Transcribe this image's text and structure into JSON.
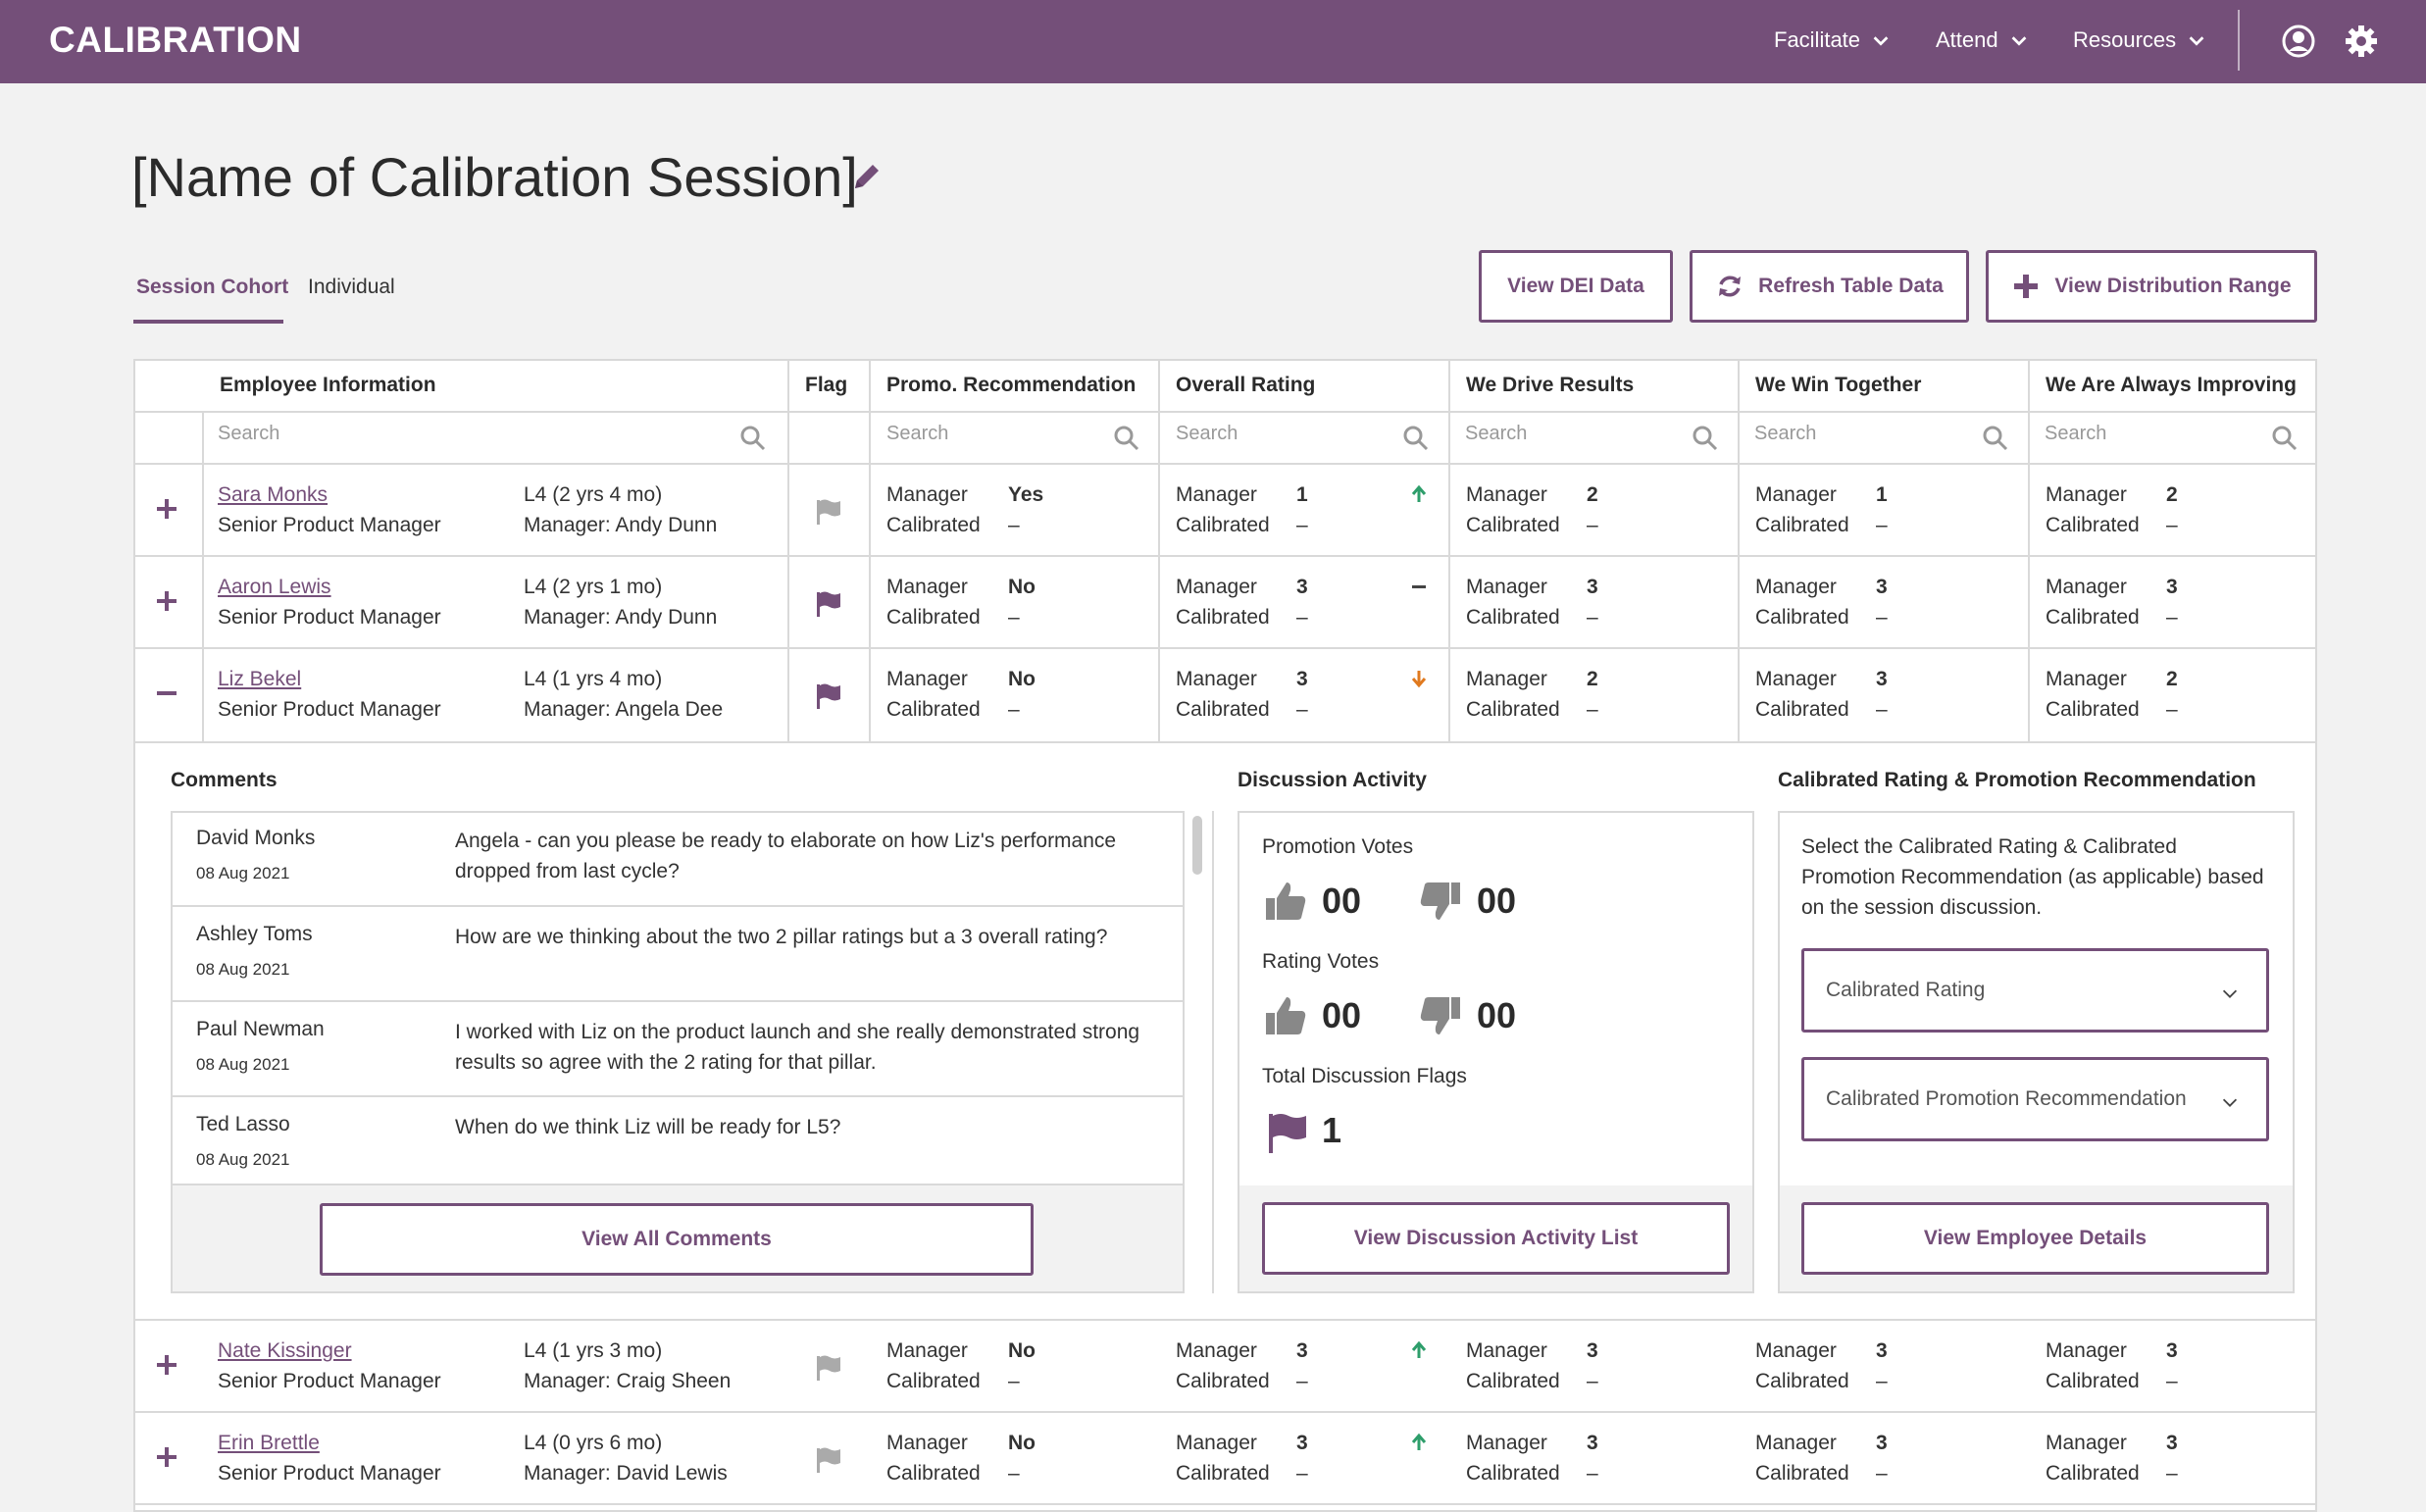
{
  "app": {
    "logo": "CALIBRATION"
  },
  "nav": {
    "facilitate": "Facilitate",
    "attend": "Attend",
    "resources": "Resources"
  },
  "page": {
    "title": "[Name of Calibration Session]"
  },
  "tabs": {
    "cohort": "Session Cohort",
    "individual": "Individual"
  },
  "actions": {
    "dei": "View DEI Data",
    "refresh": "Refresh Table Data",
    "distribution": "View Distribution Range"
  },
  "columns": {
    "employee": "Employee Information",
    "flag": "Flag",
    "promo": "Promo. Recommendation",
    "overall": "Overall Rating",
    "results": "We Drive Results",
    "together": "We Win Together",
    "improving": "We Are Always Improving"
  },
  "search": {
    "placeholder": "Search"
  },
  "cell_labels": {
    "top": "Manager",
    "bottom": "Calibrated",
    "dash": "–"
  },
  "rows": [
    {
      "name": "Sara Monks",
      "title": "Senior Product Manager",
      "level": "L4 (2 yrs 4 mo)",
      "manager": "Manager: Andy Dunn",
      "promo": "Yes",
      "overall": "1",
      "results": "2",
      "together": "1",
      "improving": "2",
      "trend": "up",
      "flagged": false
    },
    {
      "name": "Aaron Lewis",
      "title": "Senior Product Manager",
      "level": "L4 (2 yrs 1 mo)",
      "manager": "Manager: Andy Dunn",
      "promo": "No",
      "overall": "3",
      "results": "3",
      "together": "3",
      "improving": "3",
      "trend": "flat",
      "flagged": true
    },
    {
      "name": "Liz Bekel",
      "title": "Senior Product Manager",
      "level": "L4 (1 yrs 4 mo)",
      "manager": "Manager: Angela Dee",
      "promo": "No",
      "overall": "3",
      "results": "2",
      "together": "3",
      "improving": "2",
      "trend": "down",
      "flagged": true
    },
    {
      "name": "Nate Kissinger",
      "title": "Senior Product Manager",
      "level": "L4 (1 yrs 3 mo)",
      "manager": "Manager: Craig Sheen",
      "promo": "No",
      "overall": "3",
      "results": "3",
      "together": "3",
      "improving": "3",
      "trend": "up",
      "flagged": false
    },
    {
      "name": "Erin Brettle",
      "title": "Senior Product Manager",
      "level": "L4 (0 yrs 6 mo)",
      "manager": "Manager: David Lewis",
      "promo": "No",
      "overall": "3",
      "results": "3",
      "together": "3",
      "improving": "3",
      "trend": "up",
      "flagged": false
    }
  ],
  "details": {
    "comments_title": "Comments",
    "comments": [
      {
        "name": "David Monks",
        "date": "08 Aug 2021",
        "text": "Angela - can you please be ready to elaborate on how Liz's performance dropped from last cycle?"
      },
      {
        "name": "Ashley Toms",
        "date": "08 Aug 2021",
        "text": "How are we thinking about the two 2 pillar ratings but a 3 overall rating?"
      },
      {
        "name": "Paul Newman",
        "date": "08 Aug 2021",
        "text": "I worked with Liz on the product launch and she really demonstrated strong results so agree with the 2 rating for that pillar."
      },
      {
        "name": "Ted Lasso",
        "date": "08 Aug 2021",
        "text": "When do we think Liz will be ready for L5?"
      }
    ],
    "view_all_comments": "View All Comments",
    "discussion_title": "Discussion Activity",
    "promotion_votes_label": "Promotion Votes",
    "promotion_up": "00",
    "promotion_down": "00",
    "rating_votes_label": "Rating Votes",
    "rating_up": "00",
    "rating_down": "00",
    "flags_label": "Total Discussion Flags",
    "flags_count": "1",
    "view_discussion": "View Discussion Activity List",
    "calibrated_title": "Calibrated Rating & Promotion Recommendation",
    "calibrated_text": "Select the Calibrated Rating & Calibrated Promotion Recommendation (as applicable) based on the session discussion.",
    "select_rating": "Calibrated Rating",
    "select_promo": "Calibrated Promotion Recommendation",
    "view_employee": "View Employee Details"
  },
  "colors": {
    "brand": "#744f79",
    "up": "#2e9e6b",
    "down": "#e07a1f"
  }
}
